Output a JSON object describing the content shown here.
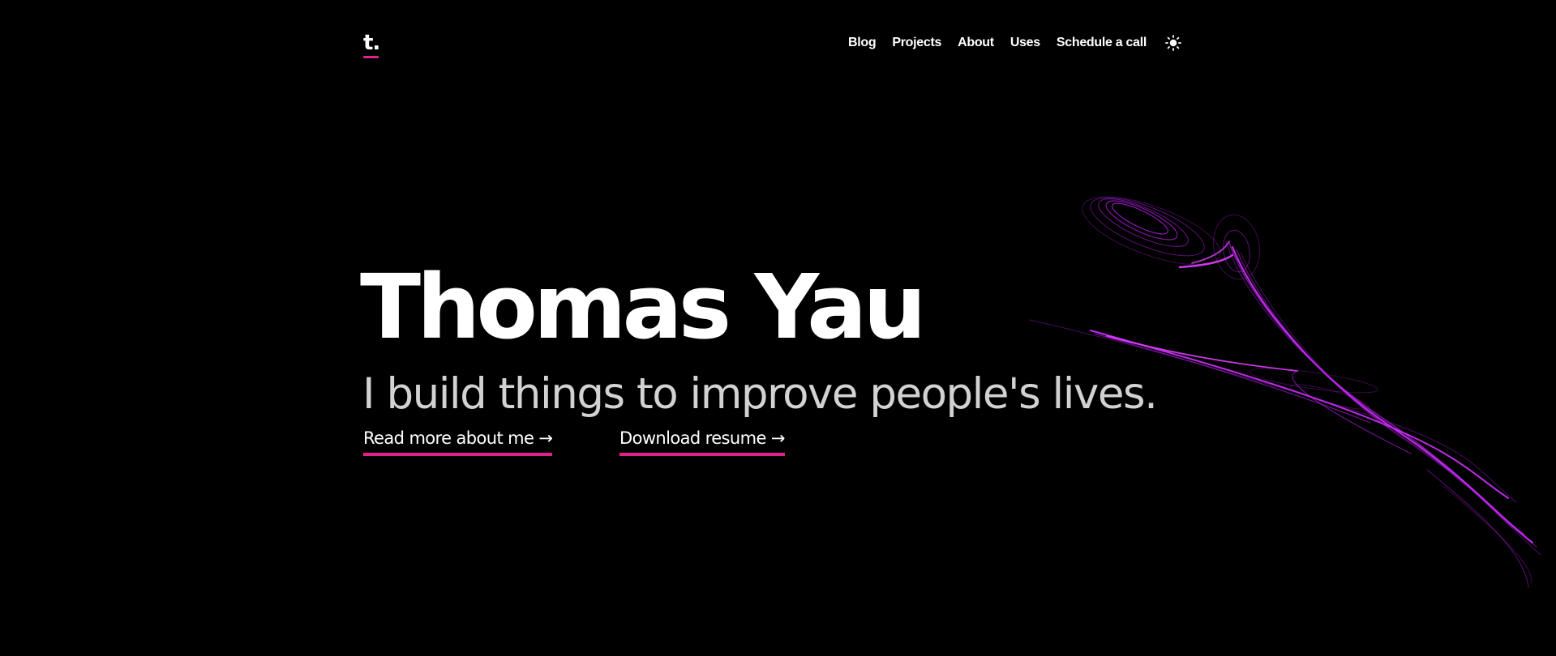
{
  "header": {
    "logo_text": "t.",
    "nav": [
      {
        "label": "Blog"
      },
      {
        "label": "Projects"
      },
      {
        "label": "About"
      },
      {
        "label": "Uses"
      },
      {
        "label": "Schedule a call"
      }
    ],
    "theme_toggle_icon": "sun-icon"
  },
  "hero": {
    "name": "Thomas Yau",
    "tagline": "I build things to improve people's lives.",
    "links": [
      {
        "label": "Read more about me →"
      },
      {
        "label": "Download resume →"
      }
    ]
  },
  "decoration": {
    "icon": "strange-attractor-art"
  },
  "colors": {
    "background": "#000000",
    "text": "#ffffff",
    "tagline": "#d2d2d2",
    "accent": "#e0218a",
    "art": "#c81ef0"
  }
}
